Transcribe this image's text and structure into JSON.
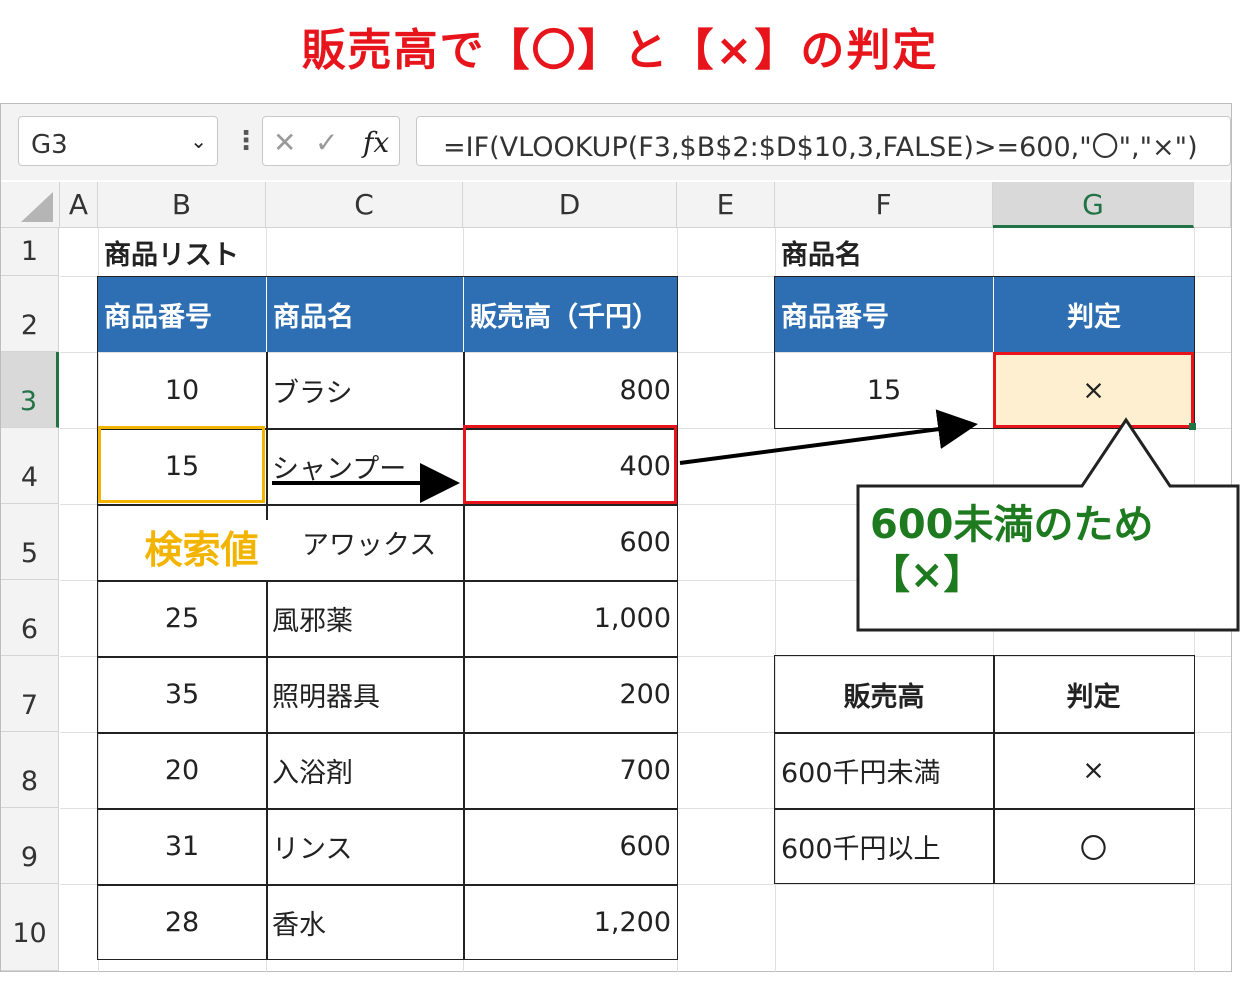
{
  "title": "販売高で【〇】と【×】の判定",
  "name_box": "G3",
  "formula_bar": {
    "fx_label": "fx",
    "formula": "=IF(VLOOKUP(F3,$B$2:$D$10,3,FALSE)>=600,\"〇\",\"×\")"
  },
  "columns": [
    "A",
    "B",
    "C",
    "D",
    "E",
    "F",
    "G"
  ],
  "rows": [
    "1",
    "2",
    "3",
    "4",
    "5",
    "6",
    "7",
    "8",
    "9",
    "10"
  ],
  "product_list": {
    "title": "商品リスト",
    "headers": [
      "商品番号",
      "商品名",
      "販売高（千円）"
    ],
    "rows": [
      [
        "10",
        "ブラシ",
        "800"
      ],
      [
        "15",
        "シャンプー",
        "400"
      ],
      [
        "",
        "アワックス",
        "600"
      ],
      [
        "25",
        "風邪薬",
        "1,000"
      ],
      [
        "35",
        "照明器具",
        "200"
      ],
      [
        "20",
        "入浴剤",
        "700"
      ],
      [
        "31",
        "リンス",
        "600"
      ],
      [
        "28",
        "香水",
        "1,200"
      ]
    ]
  },
  "lookup": {
    "title": "商品名",
    "headers": [
      "商品番号",
      "判定"
    ],
    "value": "15",
    "result": "×"
  },
  "criteria": {
    "headers": [
      "販売高",
      "判定"
    ],
    "rows": [
      [
        "600千円未満",
        "×"
      ],
      [
        "600千円以上",
        "〇"
      ]
    ]
  },
  "annotations": {
    "lookup_value_label": "検索値",
    "callout_line1": "600未満のため",
    "callout_line2": "【×】"
  },
  "colors": {
    "title": "#e8141b",
    "header_fill": "#2e6fb4",
    "result_fill": "#fdefcf",
    "highlight_red": "#e8141b",
    "highlight_orange": "#f3b400",
    "callout_green": "#1e7a1e"
  }
}
